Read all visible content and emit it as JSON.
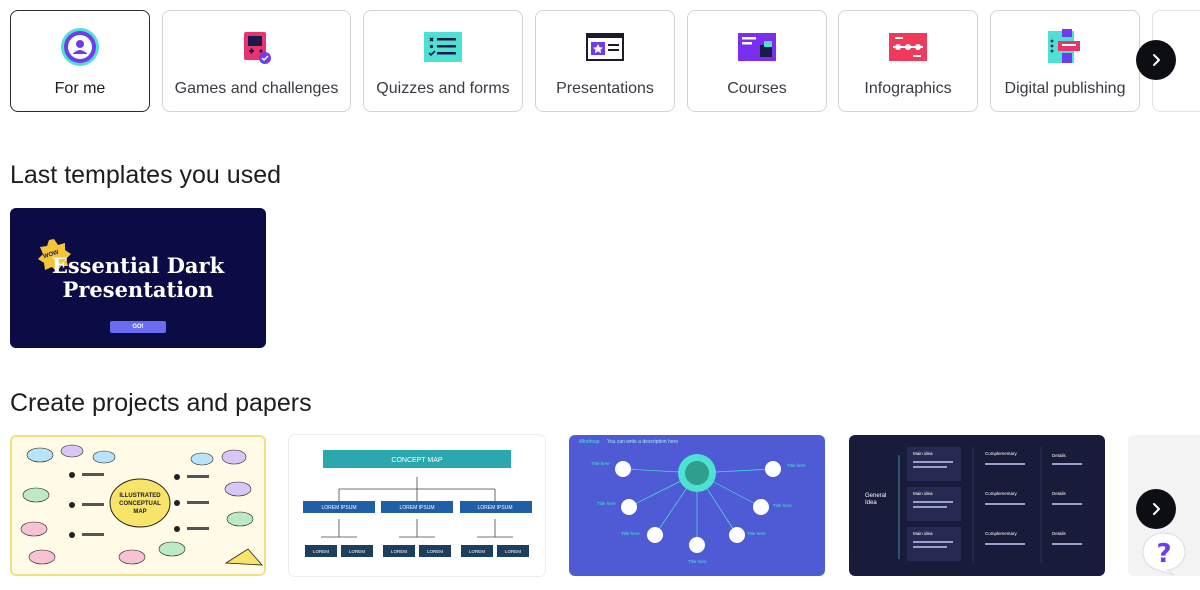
{
  "categories": [
    {
      "label": "For me",
      "icon": "user-circle-icon",
      "active": true
    },
    {
      "label": "Games and challenges",
      "icon": "game-console-icon",
      "active": false
    },
    {
      "label": "Quizzes and forms",
      "icon": "checklist-icon",
      "active": false
    },
    {
      "label": "Presentations",
      "icon": "presentation-icon",
      "active": false
    },
    {
      "label": "Courses",
      "icon": "course-icon",
      "active": false
    },
    {
      "label": "Infographics",
      "icon": "infographic-icon",
      "active": false
    },
    {
      "label": "Digital publishing",
      "icon": "digital-publishing-icon",
      "active": false
    }
  ],
  "sections": {
    "last_used_title": "Last templates you used",
    "projects_title": "Create projects and papers"
  },
  "last_template": {
    "title_line1": "Essential Dark",
    "title_line2": "Presentation",
    "badge": "WOW",
    "button": "GO!"
  },
  "projects": [
    {
      "name": "illustrated-conceptual-map",
      "title_line1": "ILLUSTRATED",
      "title_line2": "CONCEPTUAL",
      "title_line3": "MAP"
    },
    {
      "name": "concept-map",
      "header": "CONCEPT MAP",
      "box_label": "LOREM IPSUM",
      "leaf_label": "LOREM"
    },
    {
      "name": "mindmap",
      "header": "Mindmap",
      "header_sub": "You can write a description here",
      "node_label": "Title here"
    },
    {
      "name": "general-idea-table",
      "left_title_line1": "General",
      "left_title_line2": "Idea",
      "col1": "Main idea",
      "col2": "Complementary",
      "col3": "Details"
    },
    {
      "name": "next-template-partial"
    }
  ],
  "colors": {
    "accent_purple": "#6e3cf0",
    "dark_navy": "#0b0b45",
    "mindmap_blue": "#4f5bd5",
    "teal": "#2aa8ae"
  }
}
